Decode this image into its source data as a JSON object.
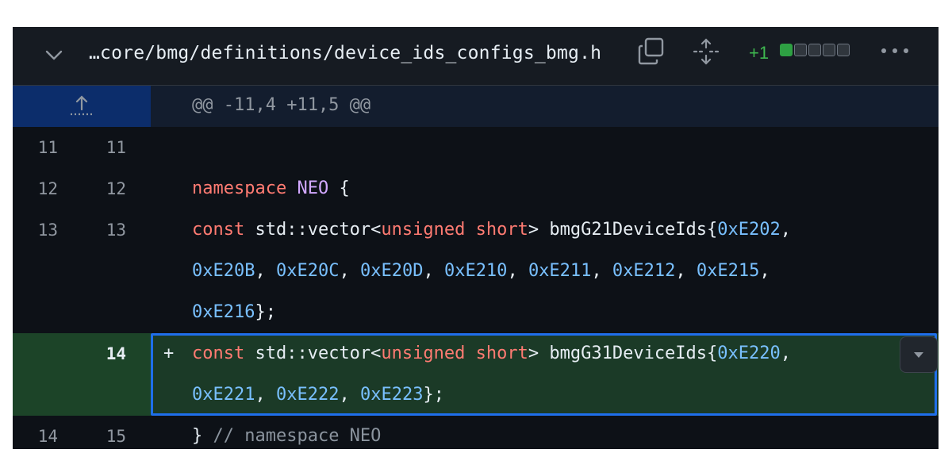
{
  "file_header": {
    "path": "…core/bmg/definitions/device_ids_configs_bmg.h",
    "diffstat_count": "+1",
    "diffstat_blocks": [
      "added",
      "neutral",
      "neutral",
      "neutral",
      "neutral"
    ],
    "icons": {
      "collapse": "chevron-down-icon",
      "copy": "copy-icon",
      "expand": "unfold-icon",
      "more": "kebab-horizontal-icon"
    }
  },
  "hunk": {
    "header": "@@ -11,4 +11,5 @@",
    "expand_icon": "expand-up-icon"
  },
  "lines": {
    "l1": {
      "old": "11",
      "new": "11"
    },
    "l2": {
      "old": "12",
      "new": "12",
      "kw": "namespace",
      "name": "NEO",
      "rest": " {"
    },
    "l3": {
      "old": "13",
      "new": "13",
      "kw1": "const",
      "t1": " std::vector<",
      "kw2": "unsigned",
      "sp": " ",
      "kw3": "short",
      "t2": "> bmgG21DeviceIds{",
      "n1": "0xE202",
      "t3": ","
    },
    "l3b": {
      "n1": "0xE20B",
      "n2": "0xE20C",
      "n3": "0xE20D",
      "n4": "0xE210",
      "n5": "0xE211",
      "n6": "0xE212",
      "n7": "0xE215",
      "sep": ", ",
      "end": ","
    },
    "l3c": {
      "n1": "0xE216",
      "end": "};"
    },
    "added": {
      "new": "14",
      "marker": "+",
      "kw1": "const",
      "t1": " std::vector<",
      "kw2": "unsigned",
      "sp": " ",
      "kw3": "short",
      "t2": "> bmgG31DeviceIds{",
      "n1": "0xE220",
      "t3": ","
    },
    "added_b": {
      "n1": "0xE221",
      "n2": "0xE222",
      "n3": "0xE223",
      "sep": ", ",
      "end": "};"
    },
    "l5": {
      "old": "14",
      "new": "15",
      "brace": "} ",
      "comment": "// namespace NEO"
    }
  },
  "colors": {
    "keyword": "#ff7b72",
    "entity": "#d2a8ff",
    "constant": "#79c0ff",
    "added_bg": "#1b3a27",
    "selection": "#1f6feb"
  }
}
